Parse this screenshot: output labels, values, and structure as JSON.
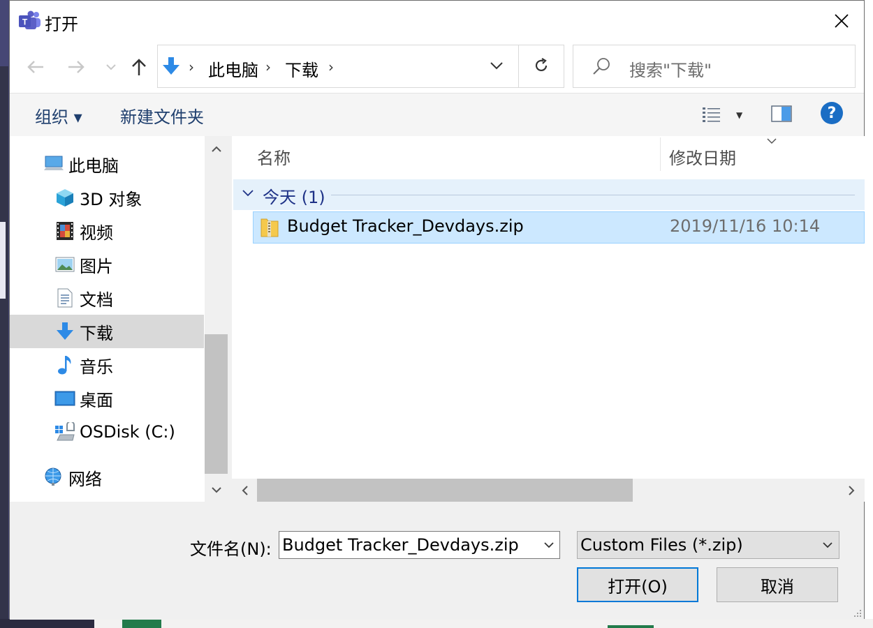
{
  "dialog": {
    "title": "打开",
    "close_label": "✕"
  },
  "nav": {
    "address_segments": [
      "此电脑",
      "下载"
    ],
    "search_placeholder": "搜索\"下载\""
  },
  "toolbar": {
    "organize": "组织 ▾",
    "new_folder": "新建文件夹"
  },
  "sidebar": {
    "items": [
      {
        "label": "此电脑",
        "icon": "computer-icon"
      },
      {
        "label": "3D 对象",
        "icon": "cube-icon"
      },
      {
        "label": "视频",
        "icon": "video-icon"
      },
      {
        "label": "图片",
        "icon": "picture-icon"
      },
      {
        "label": "文档",
        "icon": "document-icon"
      },
      {
        "label": "下载",
        "icon": "download-icon",
        "selected": true
      },
      {
        "label": "音乐",
        "icon": "music-icon"
      },
      {
        "label": "桌面",
        "icon": "desktop-icon"
      },
      {
        "label": "OSDisk (C:)",
        "icon": "drive-icon"
      },
      {
        "label": "网络",
        "icon": "network-icon"
      }
    ]
  },
  "files": {
    "columns": {
      "name": "名称",
      "date": "修改日期"
    },
    "group": "今天 (1)",
    "rows": [
      {
        "name": "Budget Tracker_Devdays.zip",
        "date": "2019/11/16 10:14",
        "icon": "zip-folder-icon"
      }
    ]
  },
  "footer": {
    "filename_label": "文件名(N):",
    "filename_value": "Budget Tracker_Devdays.zip",
    "filetype_value": "Custom Files (*.zip)",
    "open_button": "打开(O)",
    "cancel_button": "取消"
  },
  "colors": {
    "accent": "#0078d7",
    "selection": "#cce8ff",
    "group_bg": "#e5f1fb",
    "teams": "#5558af"
  }
}
